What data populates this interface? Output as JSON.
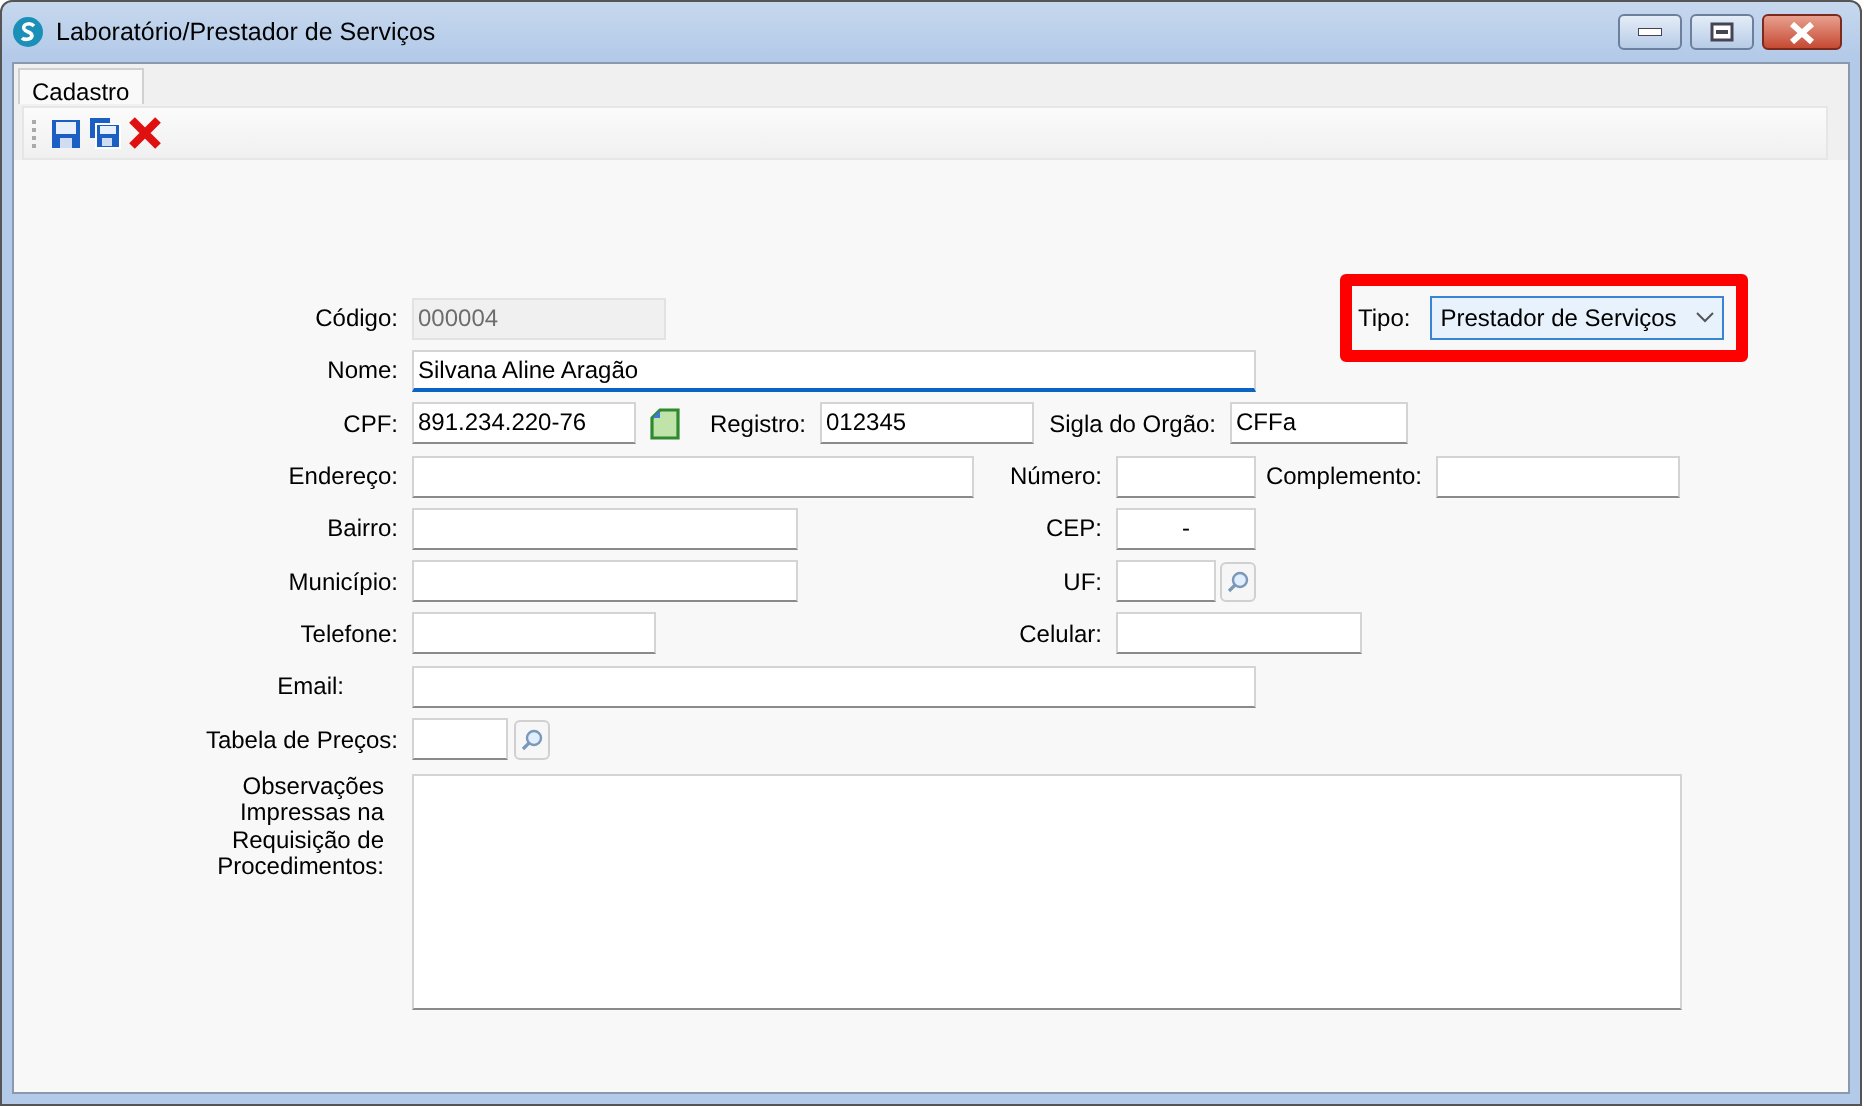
{
  "window": {
    "title": "Laboratório/Prestador de Serviços"
  },
  "tabs": [
    {
      "label": "Cadastro",
      "selected": true
    }
  ],
  "tipo": {
    "label": "Tipo:",
    "value": "Prestador de Serviços",
    "highlighted": true
  },
  "form": {
    "rows": [
      {
        "items": [
          {
            "kind": "label",
            "text": "Código:"
          },
          {
            "kind": "input",
            "value": "000004",
            "disabled": true,
            "focused": false
          }
        ]
      },
      {
        "items": [
          {
            "kind": "label",
            "text": "Nome:"
          },
          {
            "kind": "input",
            "value": "Silvana Aline Aragão",
            "disabled": false,
            "focused": true
          }
        ]
      },
      {
        "items": [
          {
            "kind": "label",
            "text": "CPF:"
          },
          {
            "kind": "input",
            "value": "891.234.220-76",
            "disabled": false,
            "focused": false
          },
          {
            "kind": "doc"
          },
          {
            "kind": "label",
            "text": "Registro:"
          },
          {
            "kind": "input",
            "value": "012345",
            "disabled": false,
            "focused": false
          },
          {
            "kind": "label",
            "text": "Sigla do Orgão:"
          },
          {
            "kind": "input",
            "value": "CFFa",
            "disabled": false,
            "focused": false
          }
        ]
      },
      {
        "items": [
          {
            "kind": "label",
            "text": "Endereço:"
          },
          {
            "kind": "input",
            "disabled": false,
            "focused": false
          },
          {
            "kind": "label",
            "text": "Número:"
          },
          {
            "kind": "input",
            "disabled": false,
            "focused": false
          },
          {
            "kind": "label",
            "text": "Complemento:"
          },
          {
            "kind": "input",
            "disabled": false,
            "focused": false
          }
        ]
      },
      {
        "items": [
          {
            "kind": "label",
            "text": "Bairro:"
          },
          {
            "kind": "input",
            "disabled": false,
            "focused": false
          },
          {
            "kind": "label",
            "text": "CEP:"
          },
          {
            "kind": "input",
            "value": "-",
            "disabled": false,
            "focused": false
          }
        ]
      },
      {
        "items": [
          {
            "kind": "label",
            "text": "Município:"
          },
          {
            "kind": "input",
            "disabled": false,
            "focused": false
          },
          {
            "kind": "label",
            "text": "UF:"
          },
          {
            "kind": "input",
            "disabled": false,
            "focused": false
          },
          {
            "kind": "search"
          }
        ]
      },
      {
        "items": [
          {
            "kind": "label",
            "text": "Telefone:"
          },
          {
            "kind": "input",
            "disabled": false,
            "focused": false
          },
          {
            "kind": "label",
            "text": "Celular:"
          },
          {
            "kind": "input",
            "disabled": false,
            "focused": false
          }
        ]
      },
      {
        "items": [
          {
            "kind": "label",
            "text": "Email:"
          },
          {
            "kind": "input",
            "disabled": false,
            "focused": false
          }
        ]
      },
      {
        "items": [
          {
            "kind": "label",
            "text": "Tabela de Preços:"
          },
          {
            "kind": "input",
            "disabled": false,
            "focused": false
          },
          {
            "kind": "search"
          }
        ]
      },
      {
        "items": [
          {
            "kind": "label",
            "text": "Observações Impressas na Requisição de Procedimentos:"
          },
          {
            "kind": "textarea"
          }
        ]
      }
    ]
  }
}
